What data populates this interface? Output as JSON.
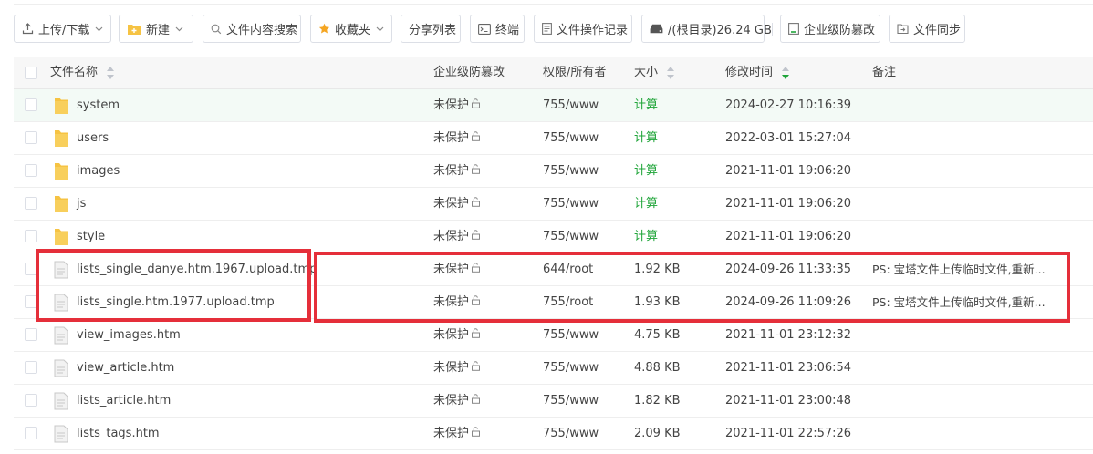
{
  "toolbar": {
    "upload": "上传/下载",
    "new": "新建",
    "search": "文件内容搜索",
    "favorites": "收藏夹",
    "share_list": "分享列表",
    "terminal": "终端",
    "ops_log": "文件操作记录",
    "disk": "/(根目录)26.24 GB",
    "tamper": "企业级防篡改",
    "sync": "文件同步"
  },
  "table": {
    "columns": {
      "name": "文件名称",
      "tamper": "企业级防篡改",
      "perm": "权限/所有者",
      "size": "大小",
      "mtime": "修改时间",
      "note": "备注"
    },
    "rows": [
      {
        "name": "system",
        "type": "folder",
        "prot": "未保护",
        "perm": "755/www",
        "size": "计算",
        "time": "2024-02-27 10:16:39",
        "note": ""
      },
      {
        "name": "users",
        "type": "folder",
        "prot": "未保护",
        "perm": "755/www",
        "size": "计算",
        "time": "2022-03-01 15:27:04",
        "note": ""
      },
      {
        "name": "images",
        "type": "folder",
        "prot": "未保护",
        "perm": "755/www",
        "size": "计算",
        "time": "2021-11-01 19:06:20",
        "note": ""
      },
      {
        "name": "js",
        "type": "folder",
        "prot": "未保护",
        "perm": "755/www",
        "size": "计算",
        "time": "2021-11-01 19:06:20",
        "note": ""
      },
      {
        "name": "style",
        "type": "folder",
        "prot": "未保护",
        "perm": "755/www",
        "size": "计算",
        "time": "2021-11-01 19:06:20",
        "note": ""
      },
      {
        "name": "lists_single_danye.htm.1967.upload.tmp",
        "type": "file",
        "prot": "未保护",
        "perm": "644/root",
        "size": "1.92 KB",
        "time": "2024-09-26 11:33:35",
        "note": "PS: 宝塔文件上传临时文件,重新..."
      },
      {
        "name": "lists_single.htm.1977.upload.tmp",
        "type": "file",
        "prot": "未保护",
        "perm": "755/root",
        "size": "1.93 KB",
        "time": "2024-09-26 11:09:26",
        "note": "PS: 宝塔文件上传临时文件,重新..."
      },
      {
        "name": "view_images.htm",
        "type": "file",
        "prot": "未保护",
        "perm": "755/www",
        "size": "4.75 KB",
        "time": "2021-11-01 23:12:32",
        "note": ""
      },
      {
        "name": "view_article.htm",
        "type": "file",
        "prot": "未保护",
        "perm": "755/www",
        "size": "4.88 KB",
        "time": "2021-11-01 23:06:54",
        "note": ""
      },
      {
        "name": "lists_article.htm",
        "type": "file",
        "prot": "未保护",
        "perm": "755/www",
        "size": "1.82 KB",
        "time": "2021-11-01 23:00:48",
        "note": ""
      },
      {
        "name": "lists_tags.htm",
        "type": "file",
        "prot": "未保护",
        "perm": "755/www",
        "size": "2.09 KB",
        "time": "2021-11-01 22:57:26",
        "note": ""
      }
    ]
  },
  "colors": {
    "accent": "#20a53a",
    "folder": "#f6c343",
    "annotation": "#e52f3a",
    "star": "#f5a623"
  }
}
